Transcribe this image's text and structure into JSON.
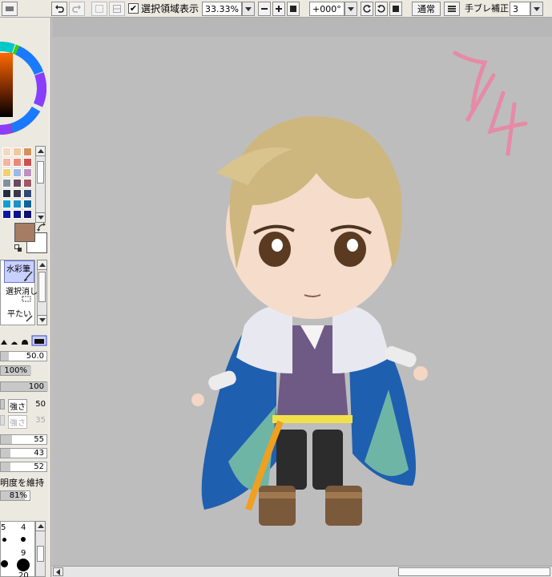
{
  "toolbar": {
    "show_selection_label": "選択領域表示",
    "show_selection_checked": "✔",
    "zoom_value": "33.33%",
    "rotation_value": "+000°",
    "blend_mode": "通常",
    "stabilizer_label": "手ブレ補正",
    "stabilizer_value": "3"
  },
  "tools": {
    "watercolor": "水彩筆",
    "select_erase": "選択消し",
    "flat": "平たい"
  },
  "brush": {
    "size": "50.0",
    "size_percent": "100%",
    "density": "100",
    "strength_label": "強さ",
    "strength_value": "50",
    "strength2_label": "強さ",
    "strength2_value": "35",
    "blend": "55",
    "dilution": "43",
    "persistence": "52",
    "keep_opacity_label": "明度を維持",
    "opacity_percent": "81%"
  },
  "brush_sizes": [
    "5",
    "4",
    "9",
    "20"
  ],
  "canvas": {
    "handwriting": "7/4"
  },
  "colors": {
    "current_fg": "#a57d64",
    "current_bg": "#ffffff"
  },
  "icons": [
    "undo-icon",
    "redo-icon",
    "deselect-icon",
    "invert-icon",
    "zoom-out-icon",
    "zoom-in-icon",
    "reset-icon",
    "rotate-left-icon",
    "rotate-right-icon",
    "swap-colors-icon",
    "brush-icon"
  ]
}
